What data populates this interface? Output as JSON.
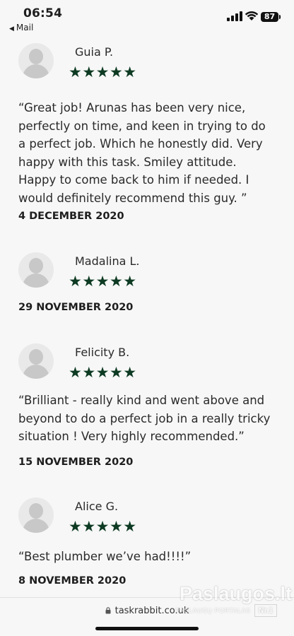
{
  "status_bar": {
    "time": "06:54",
    "back_label": "Mail",
    "back_arrow": "◀",
    "battery": "87"
  },
  "reviews": [
    {
      "name": "Guia P.",
      "stars": "★★★★★",
      "rating": 5,
      "quote": "“Great job!  Arunas has been very nice, perfectly on time, and keen in trying to do a perfect job. Which he honestly did. Very happy with this task. Smiley attitude. Happy to come back to him if needed. I would definitely recommend this guy.   ”",
      "date": "4 DECEMBER 2020"
    },
    {
      "name": "Madalina L.",
      "stars": "★★★★★",
      "rating": 5,
      "quote": "",
      "date": "29 NOVEMBER 2020"
    },
    {
      "name": "Felicity B.",
      "stars": "★★★★★",
      "rating": 5,
      "quote": "“Brilliant - really kind and went above and beyond to do a perfect job in a really tricky situation ! Very highly recommended.”",
      "date": "15 NOVEMBER 2020"
    },
    {
      "name": "Alice G.",
      "stars": "★★★★★",
      "rating": 5,
      "quote": "“Best plumber we’ve had!!!!”",
      "date": "8 NOVEMBER 2020"
    }
  ],
  "browser": {
    "url": "taskrabbit.co.uk"
  },
  "watermark": {
    "title": "Paslaugos.lt",
    "subtitle": "PASLAUGŲ PORTALAS",
    "badge": "Nr.1"
  },
  "colors": {
    "star": "#0d3a22",
    "background": "#f7f7f7",
    "avatar_bg": "#e9e9e9"
  }
}
